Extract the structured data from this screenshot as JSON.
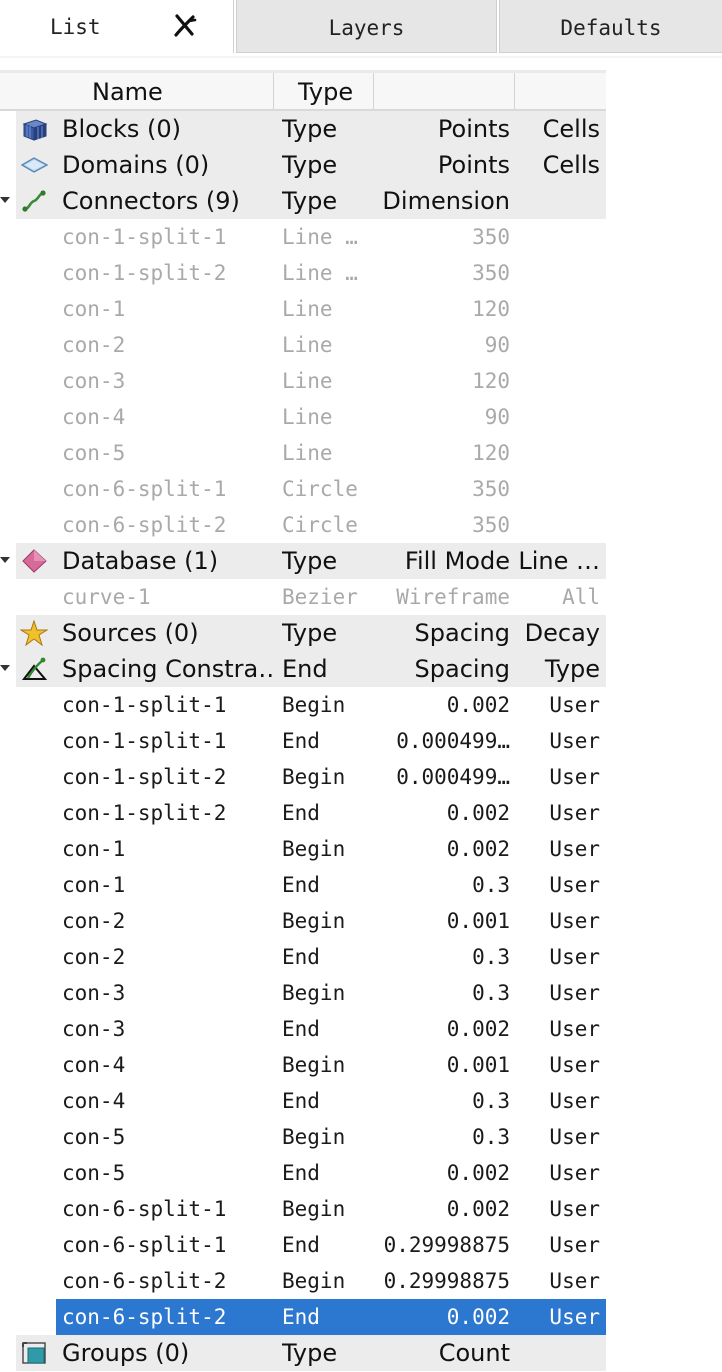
{
  "tabs": [
    {
      "label": "List"
    },
    {
      "label": "Layers"
    },
    {
      "label": "Defaults"
    }
  ],
  "columns": {
    "name": "Name",
    "type": "Type",
    "c3": "",
    "c4": ""
  },
  "categories": {
    "blocks": {
      "name": "Blocks (0)",
      "c2": "Type",
      "c3": "Points",
      "c4": "Cells",
      "icon": "cube-icon"
    },
    "domains": {
      "name": "Domains (0)",
      "c2": "Type",
      "c3": "Points",
      "c4": "Cells",
      "icon": "diamond-icon"
    },
    "connectors": {
      "name": "Connectors (9)",
      "c2": "Type",
      "c3": "Dimension",
      "c4": "",
      "icon": "curve-icon"
    },
    "database": {
      "name": "Database (1)",
      "c2": "Type",
      "c3": "Fill Mode",
      "c4": "Line …",
      "icon": "database-icon"
    },
    "sources": {
      "name": "Sources (0)",
      "c2": "Type",
      "c3": "Spacing",
      "c4": "Decay",
      "icon": "star-icon"
    },
    "spacing": {
      "name": "Spacing Constra…",
      "c2": "End",
      "c3": "Spacing",
      "c4": "Type",
      "icon": "spacing-constraint-icon"
    },
    "groups": {
      "name": "Groups (0)",
      "c2": "Type",
      "c3": "Count",
      "c4": "",
      "icon": "groups-icon"
    }
  },
  "connectors": [
    {
      "name": "con-1-split-1",
      "type": "Line …",
      "dim": "350"
    },
    {
      "name": "con-1-split-2",
      "type": "Line …",
      "dim": "350"
    },
    {
      "name": "con-1",
      "type": "Line",
      "dim": "120"
    },
    {
      "name": "con-2",
      "type": "Line",
      "dim": "90"
    },
    {
      "name": "con-3",
      "type": "Line",
      "dim": "120"
    },
    {
      "name": "con-4",
      "type": "Line",
      "dim": "90"
    },
    {
      "name": "con-5",
      "type": "Line",
      "dim": "120"
    },
    {
      "name": "con-6-split-1",
      "type": "Circle",
      "dim": "350"
    },
    {
      "name": "con-6-split-2",
      "type": "Circle",
      "dim": "350"
    }
  ],
  "database": [
    {
      "name": "curve-1",
      "type": "Bezier",
      "fill": "Wireframe",
      "line": "All"
    }
  ],
  "spacing": [
    {
      "name": "con-1-split-1",
      "end": "Begin",
      "spacing": "0.002",
      "type": "User"
    },
    {
      "name": "con-1-split-1",
      "end": "End",
      "spacing": "0.000499…",
      "type": "User"
    },
    {
      "name": "con-1-split-2",
      "end": "Begin",
      "spacing": "0.000499…",
      "type": "User"
    },
    {
      "name": "con-1-split-2",
      "end": "End",
      "spacing": "0.002",
      "type": "User"
    },
    {
      "name": "con-1",
      "end": "Begin",
      "spacing": "0.002",
      "type": "User"
    },
    {
      "name": "con-1",
      "end": "End",
      "spacing": "0.3",
      "type": "User"
    },
    {
      "name": "con-2",
      "end": "Begin",
      "spacing": "0.001",
      "type": "User"
    },
    {
      "name": "con-2",
      "end": "End",
      "spacing": "0.3",
      "type": "User"
    },
    {
      "name": "con-3",
      "end": "Begin",
      "spacing": "0.3",
      "type": "User"
    },
    {
      "name": "con-3",
      "end": "End",
      "spacing": "0.002",
      "type": "User"
    },
    {
      "name": "con-4",
      "end": "Begin",
      "spacing": "0.001",
      "type": "User"
    },
    {
      "name": "con-4",
      "end": "End",
      "spacing": "0.3",
      "type": "User"
    },
    {
      "name": "con-5",
      "end": "Begin",
      "spacing": "0.3",
      "type": "User"
    },
    {
      "name": "con-5",
      "end": "End",
      "spacing": "0.002",
      "type": "User"
    },
    {
      "name": "con-6-split-1",
      "end": "Begin",
      "spacing": "0.002",
      "type": "User"
    },
    {
      "name": "con-6-split-1",
      "end": "End",
      "spacing": "0.29998875",
      "type": "User"
    },
    {
      "name": "con-6-split-2",
      "end": "Begin",
      "spacing": "0.29998875",
      "type": "User"
    },
    {
      "name": "con-6-split-2",
      "end": "End",
      "spacing": "0.002",
      "type": "User",
      "selected": true
    }
  ],
  "colors": {
    "selection": "#2c77d0",
    "category_bg": "#ececec",
    "dim_text": "#a9a9a9"
  }
}
